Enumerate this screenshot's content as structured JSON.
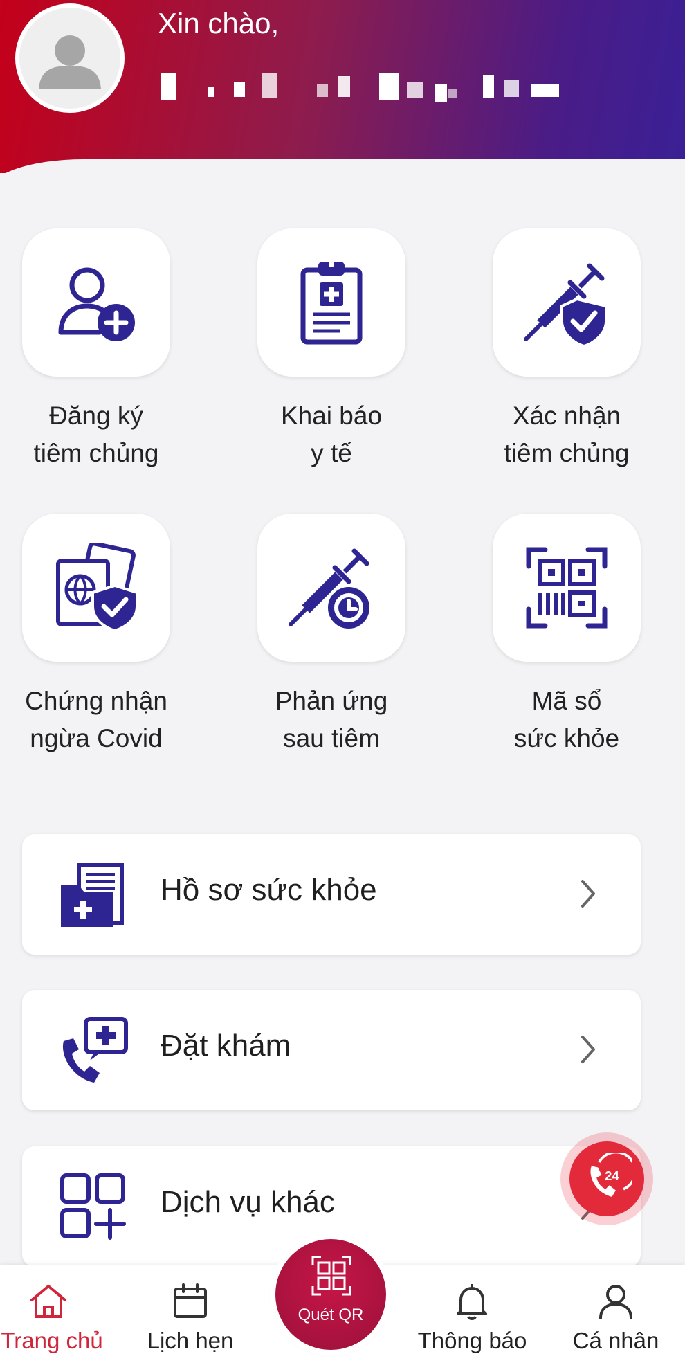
{
  "header": {
    "greeting": "Xin chào,"
  },
  "grid": [
    {
      "label": "Đăng ký\ntiêm chủng",
      "icon": "user-add-icon"
    },
    {
      "label": "Khai báo\ny tế",
      "icon": "medical-clipboard-icon"
    },
    {
      "label": "Xác nhận\ntiêm chủng",
      "icon": "syringe-shield-icon"
    },
    {
      "label": "Chứng nhận\nngừa Covid",
      "icon": "passport-shield-icon"
    },
    {
      "label": "Phản ứng\nsau tiêm",
      "icon": "syringe-clock-icon"
    },
    {
      "label": "Mã sổ\nsức khỏe",
      "icon": "qr-code-icon"
    }
  ],
  "cards": [
    {
      "label": "Hồ sơ sức khỏe",
      "icon": "health-folder-icon"
    },
    {
      "label": "Đặt khám",
      "icon": "phone-plus-icon"
    },
    {
      "label": "Dịch vụ khác",
      "icon": "apps-plus-icon"
    }
  ],
  "hotline": {
    "text": "24"
  },
  "nav": {
    "home": "Trang chủ",
    "calendar": "Lịch hẹn",
    "scan": "Quét QR",
    "notifications": "Thông báo",
    "profile": "Cá nhân"
  },
  "colors": {
    "primary": "#2e2592",
    "accent": "#d0263b",
    "header_start": "#c4001a",
    "header_end": "#3a2096"
  }
}
